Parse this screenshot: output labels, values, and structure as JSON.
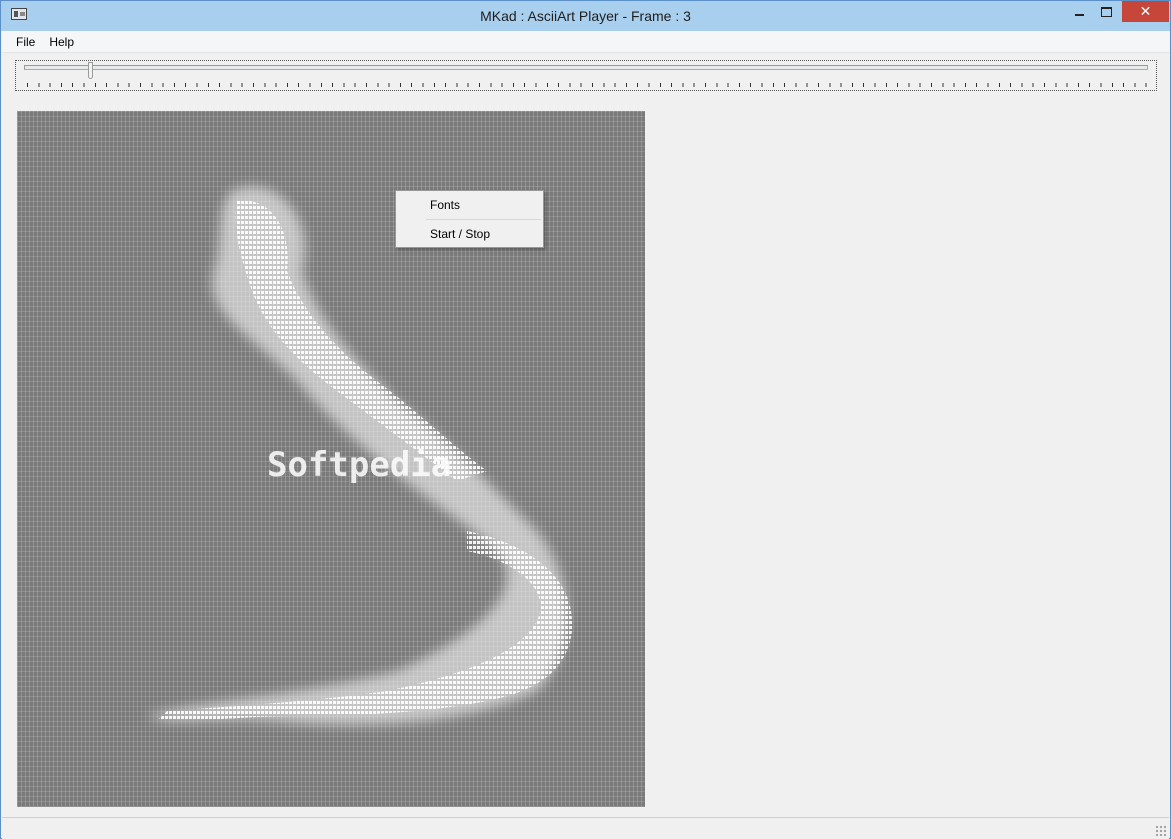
{
  "window": {
    "title": "MKad : AsciiArt Player - Frame : 3",
    "controls": {
      "minimize": "minimize-icon",
      "maximize": "maximize-icon",
      "close": "✕"
    }
  },
  "menubar": {
    "items": [
      {
        "label": "File"
      },
      {
        "label": "Help"
      }
    ]
  },
  "toolbar": {
    "frame_slider": {
      "position_fraction": 0.055
    }
  },
  "canvas": {
    "background_color": "#7a7a7a",
    "foreground_color": "#ffffff",
    "overlay_text": "Softpedia"
  },
  "context_menu": {
    "items": [
      {
        "label": "Fonts"
      },
      {
        "label": "Start / Stop"
      }
    ]
  }
}
